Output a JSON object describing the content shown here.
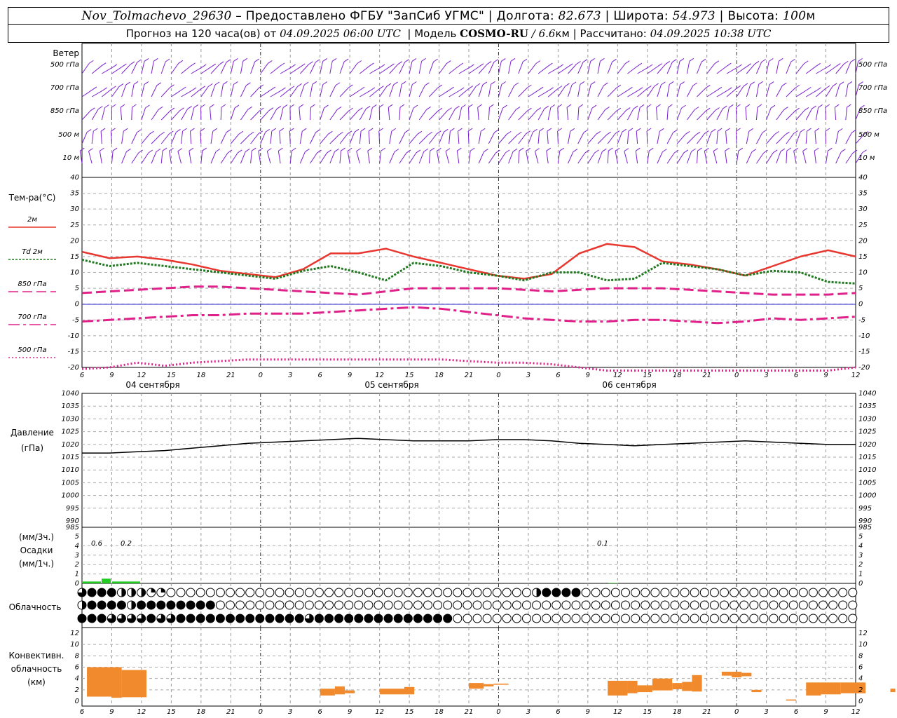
{
  "header": {
    "station": "Nov_Tolmachevo_29630",
    "provider": "– Предоставлено ФГБУ \"ЗапСиб УГМС\"",
    "lon_label": "Долгота:",
    "lon": "82.673",
    "lat_label": "Широта:",
    "lat": "54.973",
    "alt_label": "Высота:",
    "alt": "100",
    "alt_unit": "м",
    "forecast_label": "Прогноз на 120 часа(ов) от",
    "forecast_start": "04.09.2025 06:00 UTC",
    "model_label": "Модель",
    "model": "COSMO-RU",
    "resolution": "/ 6.6",
    "resolution_unit": "км",
    "computed_label": "Рассчитано:",
    "computed": "04.09.2025 10:38 UTC"
  },
  "panels": {
    "wind": {
      "title": "Ветер",
      "levels": [
        "500 гПа",
        "700 гПа",
        "850 гПа",
        "500 м",
        "10 м"
      ]
    },
    "temp": {
      "title": "Тем-ра(°С)",
      "legend": [
        {
          "label": "2м",
          "color": "#e8372f",
          "style": "solid"
        },
        {
          "label": "Td 2м",
          "color": "#1f7a1f",
          "style": "dotted"
        },
        {
          "label": "850 гПа",
          "color": "#e0218a",
          "style": "dash"
        },
        {
          "label": "700 гПа",
          "color": "#e0218a",
          "style": "dashdot"
        },
        {
          "label": "500 гПа",
          "color": "#e0218a",
          "style": "dot"
        }
      ]
    },
    "pressure": {
      "title": "Давление",
      "unit": "(гПа)"
    },
    "precip": {
      "title": "Осадки",
      "unit_top": "(мм/3ч.)",
      "unit_bottom": "(мм/1ч.)"
    },
    "cloud": {
      "title": "Облачность"
    },
    "conv": {
      "title_1": "Конвективн.",
      "title_2": "облачность",
      "unit": "(км)"
    }
  },
  "time_axis": {
    "hours": [
      "6",
      "9",
      "12",
      "15",
      "18",
      "21",
      "0",
      "3",
      "6",
      "9",
      "12",
      "15",
      "18",
      "21",
      "0",
      "3",
      "6",
      "9",
      "12",
      "15",
      "18",
      "21",
      "0",
      "3",
      "6",
      "9",
      "12"
    ],
    "dates": [
      "04 сентября",
      "05 сентября",
      "06 сентября"
    ]
  },
  "colors": {
    "t2m": "#e8372f",
    "td": "#1f7a1f",
    "upper": "#e0218a",
    "wind": "#7b1fd0",
    "precip": "#22cc22",
    "conv": "#f08a2c",
    "zero": "#2222cc"
  },
  "chart_data": [
    {
      "type": "line",
      "title": "Тем-ра(°С)",
      "x_hours": [
        0,
        3,
        6,
        9,
        12,
        15,
        18,
        21,
        24,
        27,
        30,
        33,
        36,
        39,
        42,
        45,
        48,
        51,
        54,
        57,
        60,
        63,
        66,
        69,
        72,
        75,
        78
      ],
      "ylim": [
        -20,
        40
      ],
      "series": [
        {
          "name": "2м",
          "values": [
            16.5,
            14.5,
            15,
            14,
            12.5,
            10.5,
            9.5,
            8.5,
            11,
            16,
            16,
            17.5,
            15,
            13,
            11,
            9,
            8,
            9.5,
            16,
            19,
            18,
            13.5,
            12.5,
            11,
            9,
            12,
            15,
            17,
            15
          ]
        },
        {
          "name": "Td 2м",
          "values": [
            14,
            12,
            13,
            12,
            11,
            10,
            9,
            8,
            10.5,
            12,
            10,
            7.5,
            13,
            12,
            10,
            9,
            7.5,
            10,
            10,
            7.5,
            8,
            13,
            12,
            11,
            9,
            10.5,
            10,
            7,
            6.5
          ]
        },
        {
          "name": "850 гПа",
          "values": [
            3.5,
            4,
            4.5,
            5,
            5.5,
            5.5,
            5,
            4.5,
            4,
            3.5,
            3,
            4,
            5,
            5,
            5,
            5,
            4.5,
            4,
            4.5,
            5,
            5,
            5,
            4.5,
            4,
            3.5,
            3,
            3,
            3,
            3.5
          ]
        },
        {
          "name": "700 гПа",
          "values": [
            -5.5,
            -5,
            -4.5,
            -4,
            -3.5,
            -3.5,
            -3,
            -3,
            -3,
            -2.5,
            -2,
            -1.5,
            -1,
            -1.5,
            -2.5,
            -3.5,
            -4.5,
            -5,
            -5.5,
            -5.5,
            -5,
            -5,
            -5.5,
            -6,
            -5.5,
            -4.5,
            -5,
            -4.5,
            -4
          ]
        },
        {
          "name": "500 гПа",
          "values": [
            -20.5,
            -20,
            -18.5,
            -19.5,
            -18.5,
            -18,
            -17.5,
            -17.5,
            -17.5,
            -17.5,
            -17.5,
            -17.5,
            -17.5,
            -17.5,
            -18,
            -18.5,
            -18.5,
            -19,
            -20,
            -21,
            -21,
            -21,
            -21,
            -21,
            -21,
            -21,
            -21,
            -21,
            -20
          ]
        }
      ]
    },
    {
      "type": "line",
      "title": "Давление",
      "x_hours": [
        0,
        3,
        6,
        9,
        12,
        15,
        18,
        21,
        24,
        27,
        30,
        33,
        36,
        39,
        42,
        45,
        48,
        51,
        54,
        57,
        60,
        63,
        66,
        69,
        72,
        75,
        78
      ],
      "ylim": [
        985,
        1040
      ],
      "series": [
        {
          "name": "Давление",
          "values": [
            1015.5,
            1015.5,
            1016,
            1016.5,
            1017.5,
            1018.5,
            1019.5,
            1020,
            1020.5,
            1021,
            1021.5,
            1021,
            1020.5,
            1020.5,
            1020.5,
            1021,
            1021,
            1020.5,
            1019.5,
            1019,
            1018.5,
            1019,
            1019.5,
            1020,
            1020.5,
            1020,
            1019.5,
            1019,
            1019
          ]
        }
      ]
    },
    {
      "type": "bar",
      "title": "Осадки",
      "x_hours": [
        0,
        3,
        6,
        9,
        12,
        15,
        18,
        21,
        24,
        27,
        30,
        33,
        36,
        39,
        42,
        45,
        48,
        51,
        54,
        57,
        60,
        63,
        66,
        69,
        72,
        75,
        78
      ],
      "ylim": [
        0,
        5
      ],
      "values_3h": [
        0.6,
        0.2,
        0,
        0,
        0,
        0,
        0,
        0,
        0,
        0,
        0,
        0,
        0,
        0,
        0,
        0,
        0,
        0,
        0,
        0.1,
        0
      ],
      "annotations": [
        "0.6",
        "0.2",
        "0.1"
      ]
    },
    {
      "type": "bar",
      "title": "Конвективн. облачность",
      "ylim": [
        0,
        13
      ],
      "segments": [
        {
          "h0": 0.5,
          "h1": 3.0,
          "base": 0.8,
          "top": 6.0
        },
        {
          "h0": 3.0,
          "h1": 4.0,
          "base": 0.6,
          "top": 6.0
        },
        {
          "h0": 4.0,
          "h1": 6.5,
          "base": 0.7,
          "top": 5.5
        },
        {
          "h0": 24.0,
          "h1": 25.5,
          "base": 1.0,
          "top": 2.2
        },
        {
          "h0": 25.5,
          "h1": 26.5,
          "base": 1.2,
          "top": 2.6
        },
        {
          "h0": 26.5,
          "h1": 27.5,
          "base": 1.4,
          "top": 1.9
        },
        {
          "h0": 30.0,
          "h1": 32.5,
          "base": 1.2,
          "top": 2.2
        },
        {
          "h0": 32.5,
          "h1": 33.5,
          "base": 1.2,
          "top": 2.5
        },
        {
          "h0": 39.0,
          "h1": 40.5,
          "base": 2.2,
          "top": 3.2
        },
        {
          "h0": 40.5,
          "h1": 41.5,
          "base": 2.6,
          "top": 3.0
        },
        {
          "h0": 41.5,
          "h1": 43.0,
          "base": 2.9,
          "top": 3.1
        },
        {
          "h0": 53.0,
          "h1": 55.0,
          "base": 1.0,
          "top": 3.6
        },
        {
          "h0": 55.0,
          "h1": 56.0,
          "base": 1.4,
          "top": 3.6
        },
        {
          "h0": 56.0,
          "h1": 57.5,
          "base": 1.6,
          "top": 2.8
        },
        {
          "h0": 57.5,
          "h1": 59.5,
          "base": 1.9,
          "top": 4.0
        },
        {
          "h0": 59.5,
          "h1": 60.5,
          "base": 2.1,
          "top": 3.2
        },
        {
          "h0": 60.5,
          "h1": 61.5,
          "base": 1.8,
          "top": 3.4
        },
        {
          "h0": 61.5,
          "h1": 62.5,
          "base": 1.7,
          "top": 4.6
        },
        {
          "h0": 64.5,
          "h1": 65.5,
          "base": 4.5,
          "top": 5.2
        },
        {
          "h0": 65.5,
          "h1": 66.5,
          "base": 4.2,
          "top": 5.2
        },
        {
          "h0": 66.5,
          "h1": 67.5,
          "base": 4.4,
          "top": 5.0
        },
        {
          "h0": 67.5,
          "h1": 68.5,
          "base": 1.6,
          "top": 2.0
        },
        {
          "h0": 71.0,
          "h1": 72.0,
          "base": 0.1,
          "top": 0.3
        },
        {
          "h0": 73.0,
          "h1": 74.5,
          "base": 1.0,
          "top": 3.3
        },
        {
          "h0": 74.5,
          "h1": 76.5,
          "base": 1.2,
          "top": 3.3
        },
        {
          "h0": 76.5,
          "h1": 79.0,
          "base": 1.4,
          "top": 3.3
        },
        {
          "h0": 81.5,
          "h1": 82.0,
          "base": 1.6,
          "top": 2.2
        }
      ]
    }
  ],
  "cloud_rows": [
    "34442221100000000000000000000000000000000000002444400000000000000000000000000000000000000000000000000000000000",
    "24444244444444000000000000000000000000000000000000000000000000000000000000000000000000000000000000000000000000",
    "444333343344444444444443444444444444440000000000000000000000000000000000000000000000000000000000000000000000000"
  ]
}
